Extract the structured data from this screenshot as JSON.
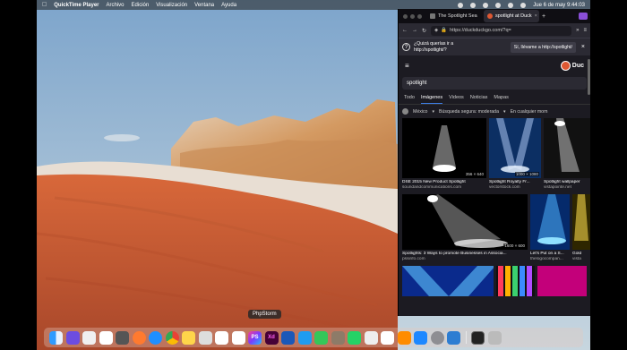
{
  "menubar": {
    "app_name": "QuickTime Player",
    "items": [
      "Archivo",
      "Edición",
      "Visualización",
      "Ventana",
      "Ayuda"
    ],
    "datetime": "Jue 6 de may  9:44:03"
  },
  "browser": {
    "tabs": [
      {
        "label": "The Spotlight Sea",
        "active": false
      },
      {
        "label": "spotlight at Duck",
        "active": true
      }
    ],
    "url": "https://duckduckgo.com/?q=",
    "suggestion": {
      "question": "¿Quizá querías ir a http://spotlight/?",
      "yes_label": "Sí, llévame a http://spotlight/"
    },
    "ddg": {
      "logo_text": "Duc",
      "query": "spotlight",
      "tabs": [
        "Todo",
        "Imágenes",
        "Videos",
        "Noticias",
        "Mapas"
      ],
      "active_tab": "Imágenes",
      "region": "México",
      "safe_search": "Búsqueda segura: moderada",
      "time_filter": "En cualquier mom"
    },
    "results": [
      {
        "title": "DSE 2015 New Product Spotlight",
        "source": "soundandcommunications.com",
        "size": "356 × 640"
      },
      {
        "title": "Spotlight Royalty Fr...",
        "source": "vectorstock.com",
        "size": "1000 × 1080"
      },
      {
        "title": "Spotlight wallpaper",
        "source": "vistapointe.net",
        "size": ""
      },
      {
        "title": "Spotlights: 3 Ways to promote Businesses in Associa...",
        "source": "pssinfo.com",
        "size": "1600 × 600"
      },
      {
        "title": "Let's Put on a S...",
        "source": "thelogocompan...",
        "size": ""
      },
      {
        "title": "Gold",
        "source": "vista",
        "size": ""
      }
    ]
  },
  "dock": {
    "tooltip": "PhpStorm",
    "icons": [
      "finder-icon",
      "launchpad-icon",
      "photos-icon",
      "calendar-icon",
      "calculator-icon",
      "firefox-icon",
      "safari-icon",
      "chrome-icon",
      "notes-icon",
      "preview-icon",
      "reminders-icon",
      "mail-icon",
      "phpstorm-icon",
      "xd-icon",
      "virtualbox-icon",
      "vscode-icon",
      "messages-icon",
      "gimp-icon",
      "whatsapp-icon",
      "script-icon",
      "camera-icon",
      "books-icon",
      "appstore-icon",
      "settings-icon",
      "photoshop-icon",
      "terminal-icon",
      "trash-icon"
    ],
    "phpstorm_text": "PS",
    "xd_text": "Xd"
  }
}
